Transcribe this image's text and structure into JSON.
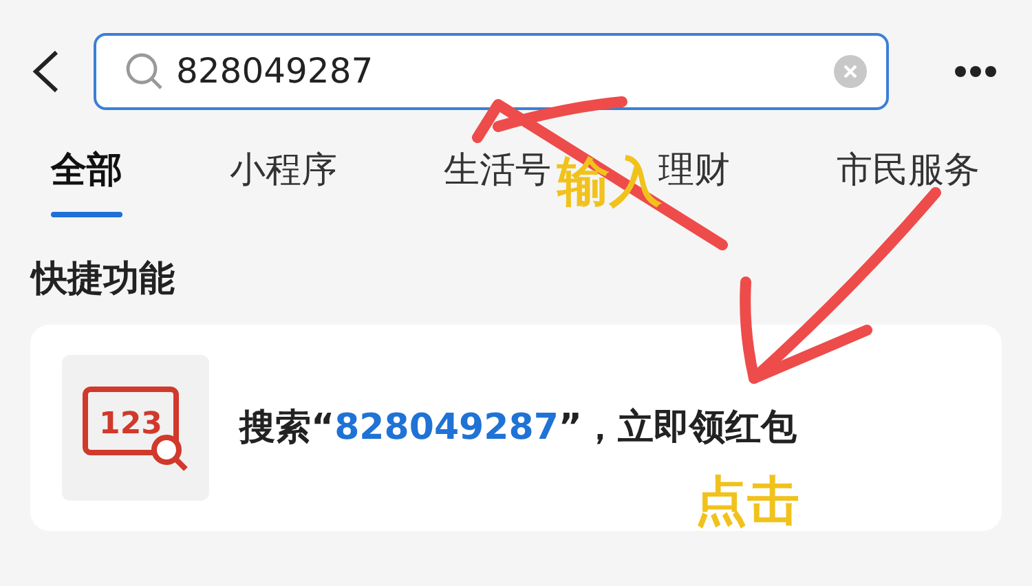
{
  "search": {
    "value": "828049287"
  },
  "tabs": [
    {
      "label": "全部",
      "selected": true
    },
    {
      "label": "小程序",
      "selected": false
    },
    {
      "label": "生活号",
      "selected": false
    },
    {
      "label": "理财",
      "selected": false
    },
    {
      "label": "市民服务",
      "selected": false
    }
  ],
  "section_title": "快捷功能",
  "shortcut": {
    "icon_text": "123",
    "prefix": "搜索“",
    "highlight": "828049287",
    "suffix": "”，立即领红包"
  },
  "annotations": [
    {
      "kind": "up",
      "text": "输入"
    },
    {
      "kind": "down",
      "text": "点击"
    }
  ]
}
